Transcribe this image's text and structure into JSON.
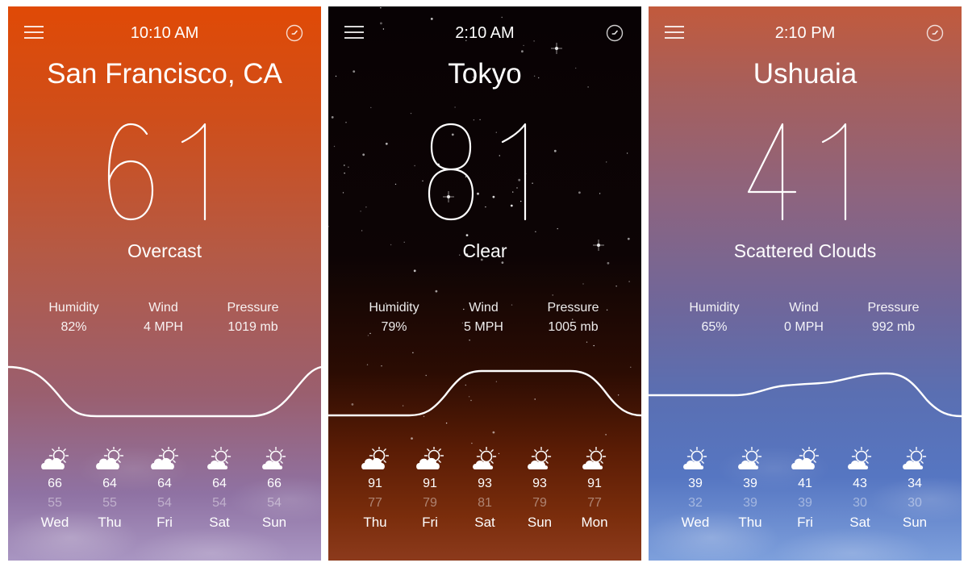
{
  "panels": [
    {
      "theme": "sunrise-overcast",
      "time": "10:10 AM",
      "city": "San Francisco, CA",
      "temperature": "61",
      "condition": "Overcast",
      "stats": [
        {
          "label": "Humidity",
          "value": "82%"
        },
        {
          "label": "Wind",
          "value": "4 MPH"
        },
        {
          "label": "Pressure",
          "value": "1019 mb"
        }
      ],
      "forecast": [
        {
          "day": "Wed",
          "high": "66",
          "low": "55",
          "icon": "mostly-cloudy-icon"
        },
        {
          "day": "Thu",
          "high": "64",
          "low": "55",
          "icon": "mostly-cloudy-icon"
        },
        {
          "day": "Fri",
          "high": "64",
          "low": "54",
          "icon": "mostly-cloudy-icon"
        },
        {
          "day": "Sat",
          "high": "64",
          "low": "54",
          "icon": "partly-cloudy-icon"
        },
        {
          "day": "Sun",
          "high": "66",
          "low": "54",
          "icon": "partly-cloudy-icon"
        }
      ]
    },
    {
      "theme": "night-clear",
      "time": "2:10 AM",
      "city": "Tokyo",
      "temperature": "81",
      "condition": "Clear",
      "stats": [
        {
          "label": "Humidity",
          "value": "79%"
        },
        {
          "label": "Wind",
          "value": "5 MPH"
        },
        {
          "label": "Pressure",
          "value": "1005 mb"
        }
      ],
      "forecast": [
        {
          "day": "Thu",
          "high": "91",
          "low": "77",
          "icon": "mostly-cloudy-icon"
        },
        {
          "day": "Fri",
          "high": "91",
          "low": "79",
          "icon": "mostly-cloudy-icon"
        },
        {
          "day": "Sat",
          "high": "93",
          "low": "81",
          "icon": "partly-cloudy-icon"
        },
        {
          "day": "Sun",
          "high": "93",
          "low": "79",
          "icon": "partly-cloudy-icon"
        },
        {
          "day": "Mon",
          "high": "91",
          "low": "77",
          "icon": "partly-cloudy-icon"
        }
      ]
    },
    {
      "theme": "afternoon-scattered",
      "time": "2:10 PM",
      "city": "Ushuaia",
      "temperature": "41",
      "condition": "Scattered Clouds",
      "stats": [
        {
          "label": "Humidity",
          "value": "65%"
        },
        {
          "label": "Wind",
          "value": "0 MPH"
        },
        {
          "label": "Pressure",
          "value": "992 mb"
        }
      ],
      "forecast": [
        {
          "day": "Wed",
          "high": "39",
          "low": "32",
          "icon": "partly-cloudy-icon"
        },
        {
          "day": "Thu",
          "high": "39",
          "low": "39",
          "icon": "partly-cloudy-icon"
        },
        {
          "day": "Fri",
          "high": "41",
          "low": "39",
          "icon": "mostly-cloudy-icon"
        },
        {
          "day": "Sat",
          "high": "43",
          "low": "30",
          "icon": "partly-cloudy-icon"
        },
        {
          "day": "Sun",
          "high": "34",
          "low": "30",
          "icon": "partly-cloudy-icon"
        }
      ]
    }
  ],
  "icons": {
    "menu": "hamburger-menu-icon",
    "clock": "clock-icon"
  }
}
